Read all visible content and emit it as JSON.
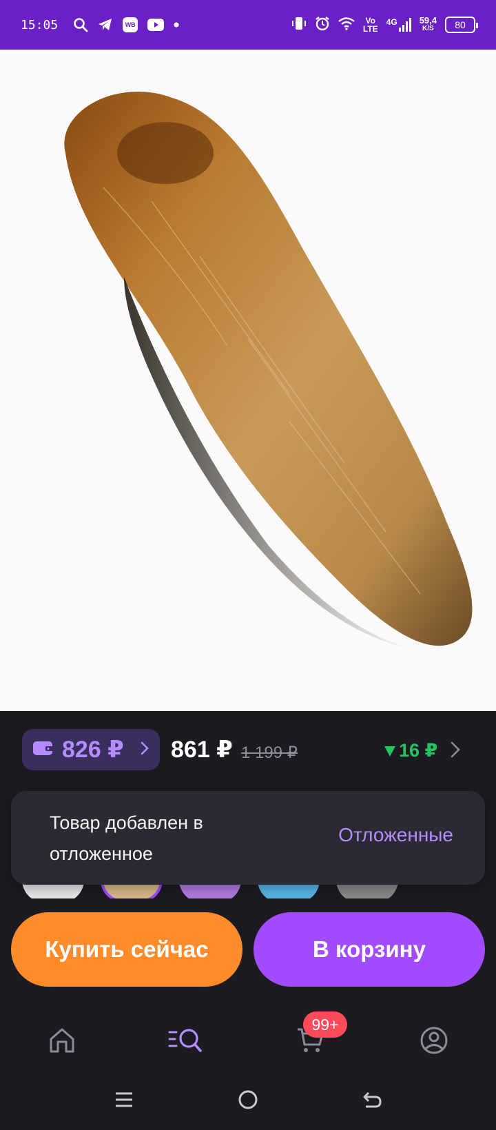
{
  "status_bar": {
    "time": "15:05",
    "wb_label": "WB",
    "volte_top": "Vo",
    "volte_bottom": "LTE",
    "network": "4G",
    "speed_value": "59,4",
    "speed_unit": "K/S",
    "battery": "80"
  },
  "price_bar": {
    "wallet_price": "826 ₽",
    "price": "861 ₽",
    "old_price": "1 199 ₽",
    "price_drop": "16 ₽",
    "accent_color": "#b48cff",
    "drop_color": "#22c55e"
  },
  "toast": {
    "message": "Товар добавлен в отложенное",
    "action": "Отложенные"
  },
  "actions": {
    "buy_now": "Купить сейчас",
    "add_to_cart": "В корзину",
    "buy_color": "#ff8b2b",
    "cart_color": "#a34bff"
  },
  "bottom_nav": {
    "items": [
      "home-icon",
      "catalog-search-icon",
      "cart-icon",
      "profile-icon"
    ],
    "cart_badge": "99+"
  }
}
